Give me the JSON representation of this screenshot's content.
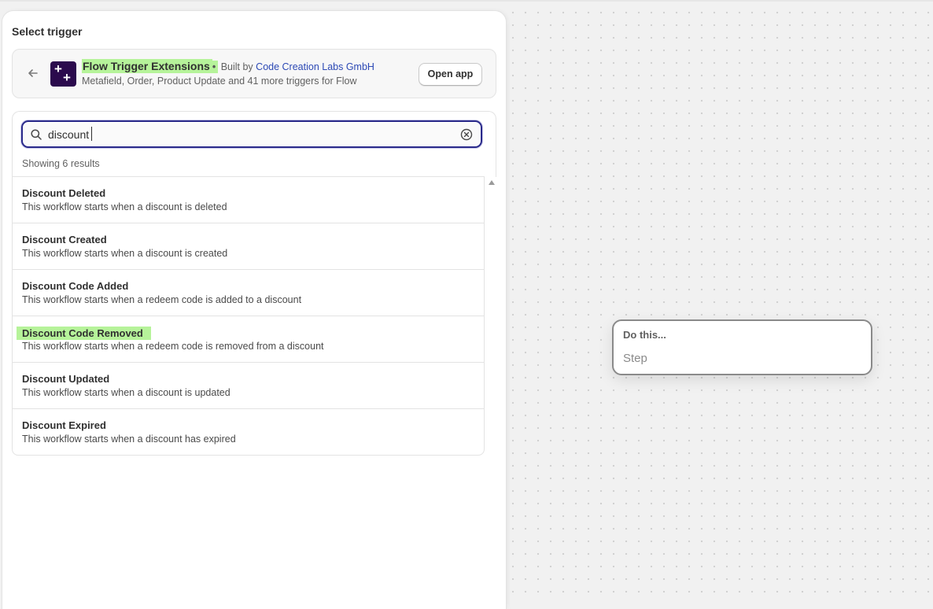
{
  "colors": {
    "highlight": "#b6f39a",
    "focus_ring": "#2a2a8a",
    "link": "#2c49b5",
    "app_logo_bg": "#2b0a4d"
  },
  "canvas": {
    "step_node": {
      "heading": "Do this...",
      "placeholder": "Step"
    }
  },
  "panel": {
    "title": "Select trigger",
    "app": {
      "back_icon": "arrow-left-icon",
      "logo_icon": "plus-plus-logo-icon",
      "name": "Flow Trigger Extensions",
      "separator": "•",
      "built_by_label": "Built by",
      "developer": "Code Creation Labs GmbH",
      "description": "Metafield, Order, Product Update and 41 more triggers for Flow",
      "open_button": "Open app"
    },
    "search": {
      "icon": "search-icon",
      "value": "discount",
      "clear_icon": "clear-circle-icon",
      "results_label": "Showing 6 results"
    },
    "results": [
      {
        "title": "Discount Deleted",
        "description": "This workflow starts when a discount is deleted",
        "highlighted": false
      },
      {
        "title": "Discount Created",
        "description": "This workflow starts when a discount is created",
        "highlighted": false
      },
      {
        "title": "Discount Code Added",
        "description": "This workflow starts when a redeem code is added to a discount",
        "highlighted": false
      },
      {
        "title": "Discount Code Removed",
        "description": "This workflow starts when a redeem code is removed from a discount",
        "highlighted": true
      },
      {
        "title": "Discount Updated",
        "description": "This workflow starts when a discount is updated",
        "highlighted": false
      },
      {
        "title": "Discount Expired",
        "description": "This workflow starts when a discount has expired",
        "highlighted": false
      }
    ]
  }
}
